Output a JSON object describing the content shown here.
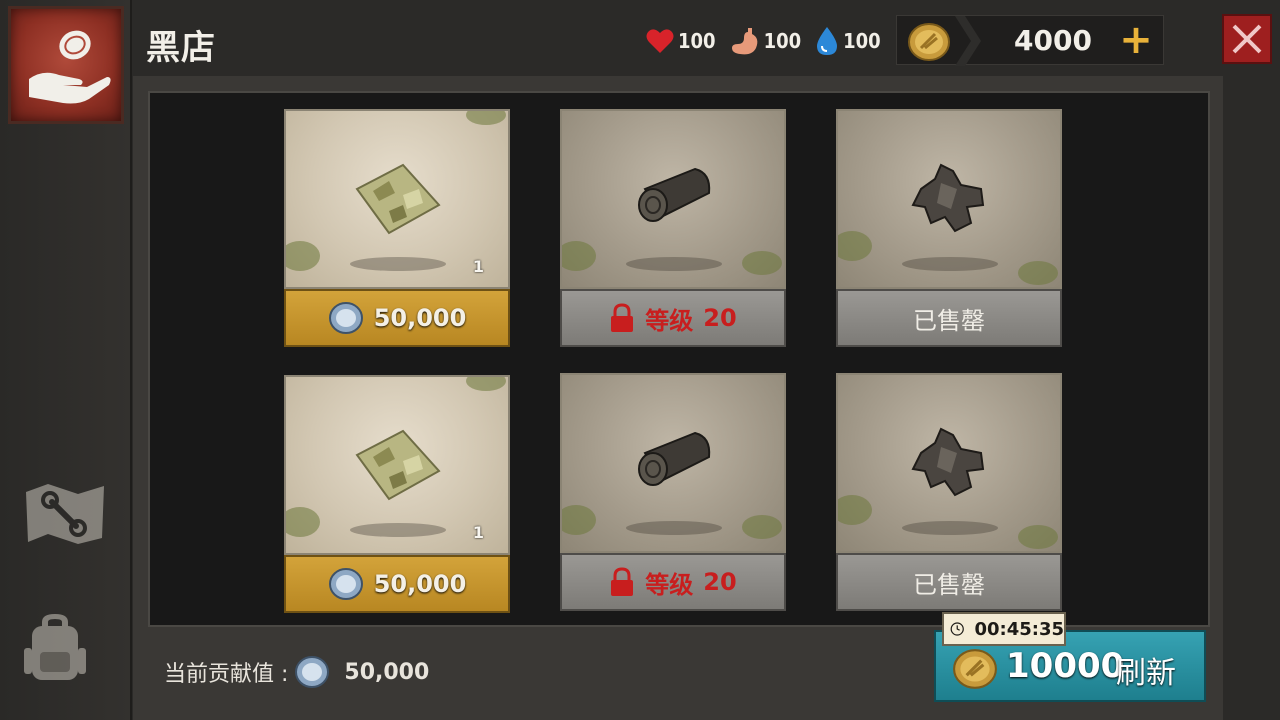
{
  "header": {
    "title": "黑店",
    "stats": {
      "health": "100",
      "hunger": "100",
      "water": "100"
    },
    "currency": {
      "value": "4000",
      "add_label": "+"
    }
  },
  "items": [
    {
      "slot": 1,
      "item": "camo-cloth-icon",
      "qty": "1",
      "state": "buy",
      "price": "50,000"
    },
    {
      "slot": 2,
      "item": "wood-log-icon",
      "qty": "",
      "state": "locked",
      "lock_label": "等级",
      "lock_level": "20"
    },
    {
      "slot": 3,
      "item": "scrap-metal-icon",
      "qty": "",
      "state": "sold",
      "sold_label": "已售罄"
    },
    {
      "slot": 4,
      "item": "camo-cloth-icon",
      "qty": "1",
      "state": "buy",
      "price": "50,000"
    },
    {
      "slot": 5,
      "item": "wood-log-icon",
      "qty": "",
      "state": "locked",
      "lock_label": "等级",
      "lock_level": "20"
    },
    {
      "slot": 6,
      "item": "scrap-metal-icon",
      "qty": "",
      "state": "sold",
      "sold_label": "已售罄"
    }
  ],
  "footer": {
    "contribution_label": "当前贡献值 :",
    "contribution_value": "50,000",
    "timer": "00:45:35",
    "refresh_cost": "10000",
    "refresh_label": "刷新"
  },
  "colors": {
    "buy_button": "#c99a30",
    "locked_text": "#c81e1e",
    "refresh_button": "#2a92a3",
    "close_button": "#9e1f1f",
    "plus_icon": "#e8b23a"
  }
}
